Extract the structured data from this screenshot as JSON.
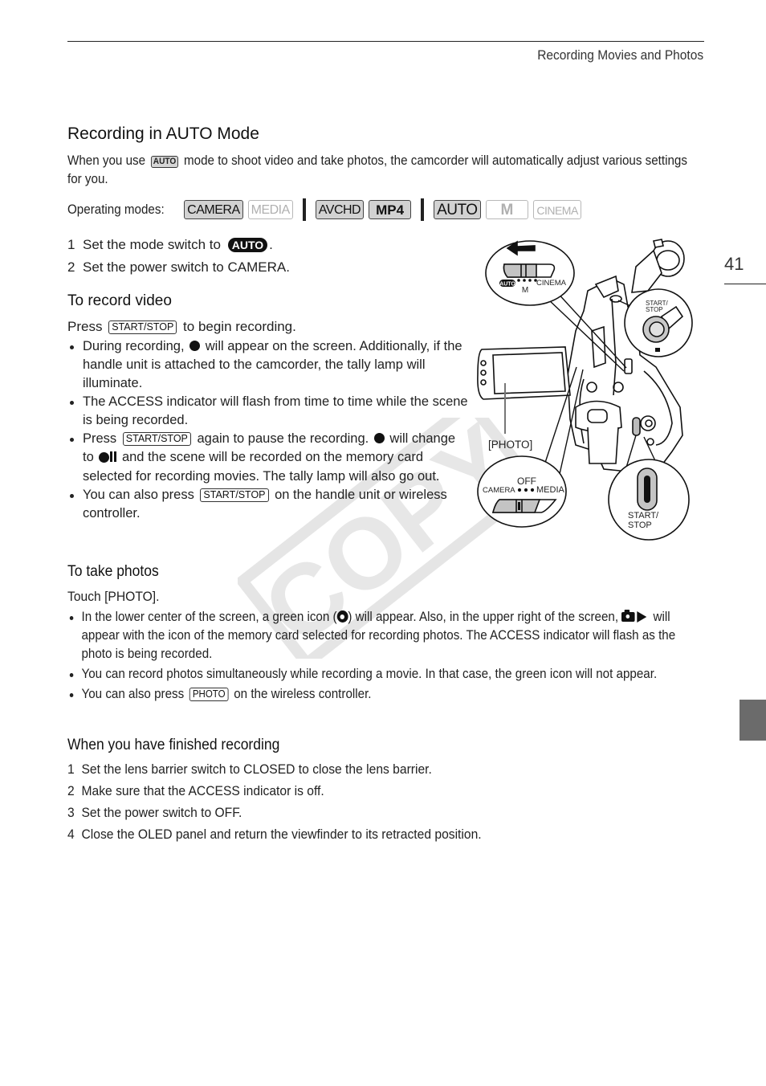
{
  "header": {
    "running_head": "Recording Movies and Photos",
    "page_number": "41"
  },
  "section": {
    "title": "Recording in AUTO Mode",
    "intro_before": "When you use",
    "intro_key": "AUTO",
    "intro_after": "mode to shoot video and take photos, the camcorder will automatically adjust various settings for you."
  },
  "operating_modes": {
    "label": "Operating modes:",
    "groups": [
      [
        {
          "label": "CAMERA",
          "active": true
        },
        {
          "label": "MEDIA",
          "active": false
        }
      ],
      [
        {
          "label": "AVCHD",
          "active": true
        },
        {
          "label": "MP4",
          "active": true
        }
      ],
      [
        {
          "label": "AUTO",
          "active": true
        },
        {
          "label": "M",
          "active": false
        },
        {
          "label": "CINEMA",
          "active": false
        }
      ]
    ]
  },
  "setup_steps": [
    {
      "num": "1",
      "before": "Set the mode switch to",
      "key": "AUTO",
      "after": "."
    },
    {
      "num": "2",
      "text": "Set the power switch to CAMERA."
    }
  ],
  "record_video": {
    "heading": "To record video",
    "press_before": "Press",
    "press_key": "START/STOP",
    "press_after": "to begin recording.",
    "bullets": [
      {
        "before": "During recording,",
        "icon": "record-dot",
        "after": "will appear on the screen. Additionally, if the handle unit is attached to the camcorder, the tally lamp will illuminate."
      },
      {
        "text": "The ACCESS indicator will flash from time to time while the scene is being recorded."
      },
      {
        "before": "Press",
        "key": "START/STOP",
        "mid1": "again to pause the recording.",
        "icon": "record-dot",
        "mid2": "will change to",
        "icon2": "record-pause",
        "after": "and the scene will be recorded on the memory card selected for recording movies. The tally lamp will also go out."
      },
      {
        "before": "You can also press",
        "key": "START/STOP",
        "after": "on the handle unit or wireless controller."
      }
    ]
  },
  "take_photos": {
    "heading": "To take photos",
    "touch": "Touch [PHOTO].",
    "bullets": [
      {
        "before": "In the lower center of the screen, a green icon (",
        "icon": "photo-ready",
        "mid": ") will appear. Also, in the upper right of the screen,",
        "icon2": "camera-play",
        "after": "will appear with the icon of the memory card selected for recording photos. The ACCESS indicator will flash as the photo is being recorded."
      },
      {
        "text": "You can record photos simultaneously while recording a movie. In that case, the green icon will not appear."
      },
      {
        "before": "You can also press",
        "key": "PHOTO",
        "after": "on the wireless controller."
      }
    ]
  },
  "finished": {
    "heading": "When you have finished recording",
    "steps": [
      {
        "num": "1",
        "text": "Set the lens barrier switch to CLOSED to close the lens barrier."
      },
      {
        "num": "2",
        "text": "Make sure that the ACCESS indicator is off."
      },
      {
        "num": "3",
        "text": "Set the power switch to OFF."
      },
      {
        "num": "4",
        "text": "Close the OLED panel and return the viewfinder to its retracted position."
      }
    ]
  },
  "illustration": {
    "mode_switch": {
      "auto": "AUTO",
      "m": "M",
      "cinema": "CINEMA"
    },
    "handle_button": {
      "label_line1": "START/",
      "label_line2": "STOP"
    },
    "photo_callout": "[PHOTO]",
    "power_switch": {
      "off": "OFF",
      "camera": "CAMERA",
      "media": "MEDIA"
    },
    "grip_button": {
      "label_line1": "START/",
      "label_line2": "STOP"
    }
  },
  "watermark": "COPY"
}
